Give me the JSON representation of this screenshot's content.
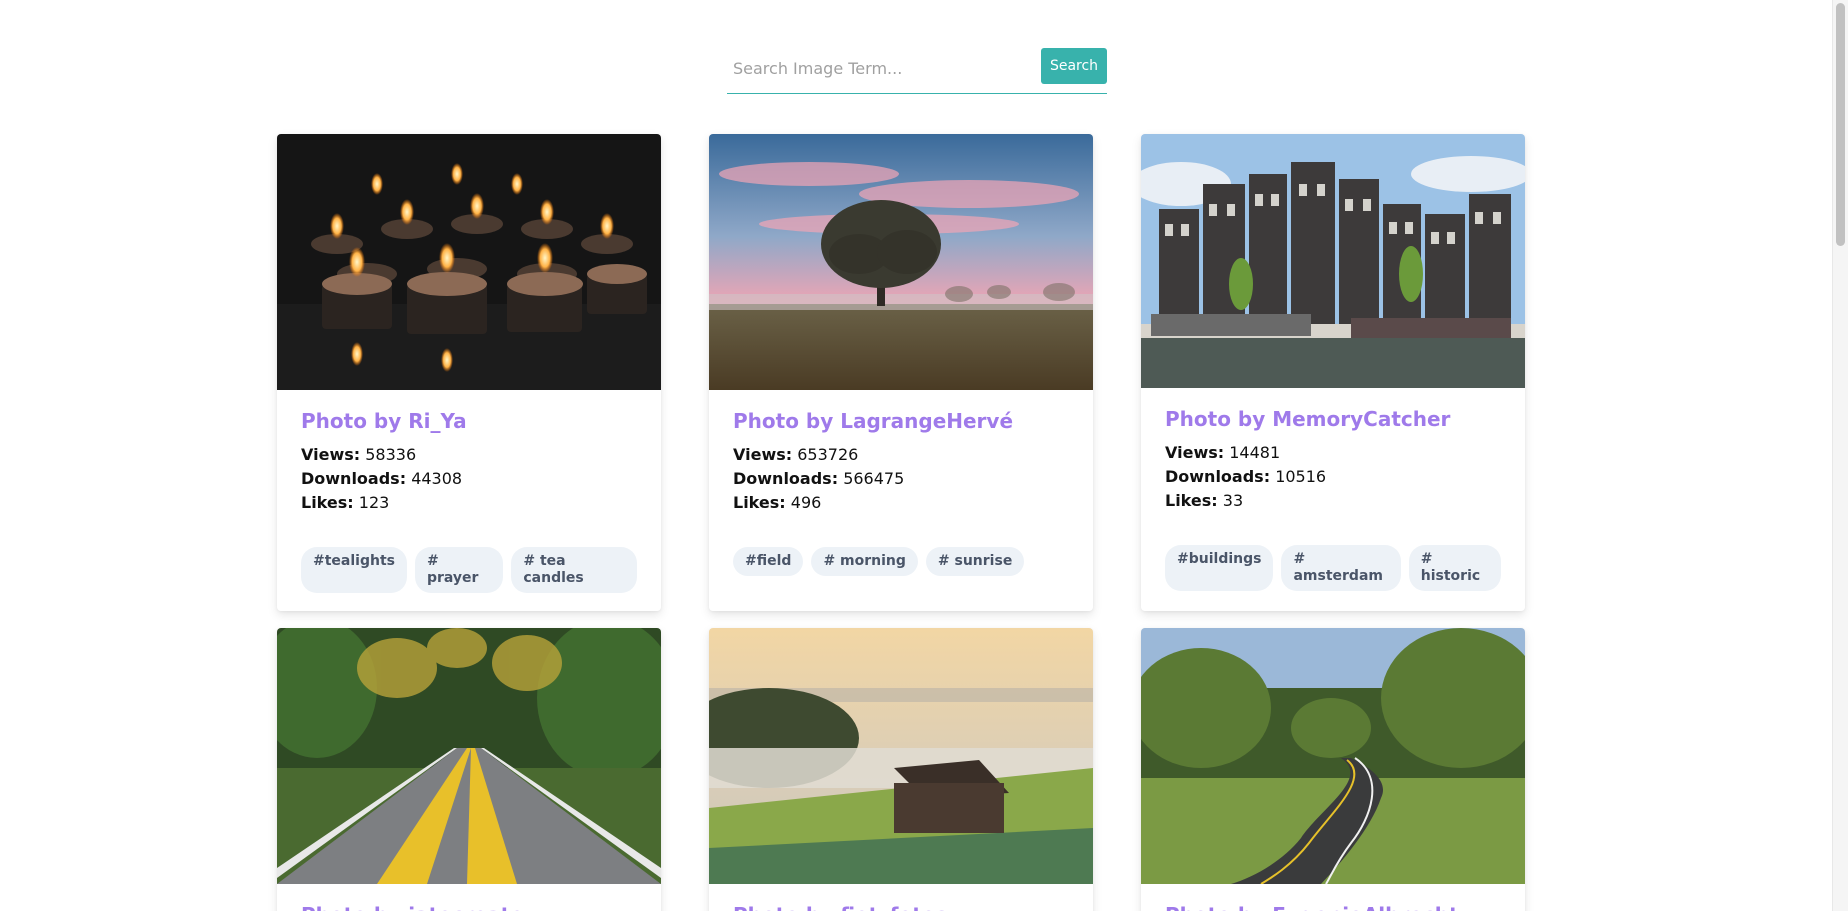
{
  "search": {
    "placeholder": "Search Image Term...",
    "value": "",
    "button_label": "Search"
  },
  "stat_labels": {
    "views": "Views:",
    "downloads": "Downloads:",
    "likes": "Likes:"
  },
  "cards": [
    {
      "title": "Photo by Ri_Ya",
      "views": "58336",
      "downloads": "44308",
      "likes": "123",
      "tags": [
        "#tealights",
        "# prayer",
        "# tea candles"
      ],
      "image_name": "tealights-image"
    },
    {
      "title": "Photo by LagrangeHervé",
      "views": "653726",
      "downloads": "566475",
      "likes": "496",
      "tags": [
        "#field",
        "# morning",
        "# sunrise"
      ],
      "image_name": "tree-field-image"
    },
    {
      "title": "Photo by MemoryCatcher",
      "views": "14481",
      "downloads": "10516",
      "likes": "33",
      "tags": [
        "#buildings",
        "# amsterdam",
        "# historic"
      ],
      "image_name": "amsterdam-houses-image"
    },
    {
      "title": "Photo by jatocreate",
      "image_name": "forest-road-image"
    },
    {
      "title": "Photo by fietzfotos",
      "image_name": "foggy-barn-image"
    },
    {
      "title": "Photo by EugenioAlbrecht",
      "image_name": "bike-path-image"
    }
  ],
  "colors": {
    "accent": "#38b2ac",
    "title": "#9f7aea",
    "tag_bg": "#edf2f7",
    "tag_text": "#4a5568"
  }
}
